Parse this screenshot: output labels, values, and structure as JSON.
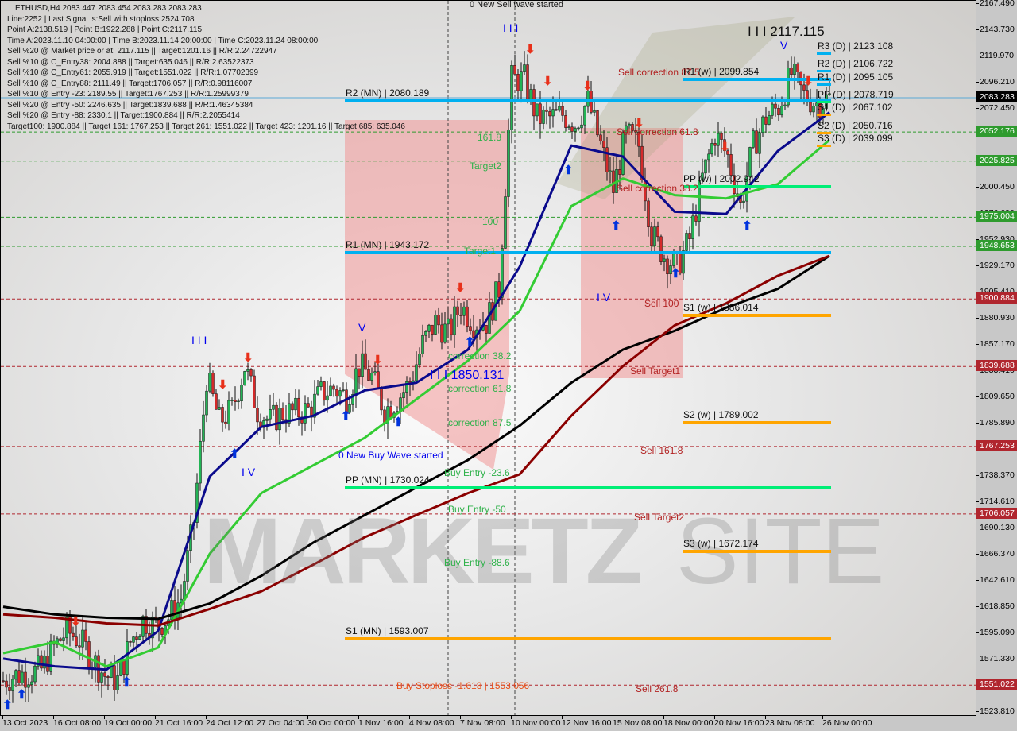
{
  "header": {
    "title": "ETHUSD,H4  2083.447 2083.454 2083.283 2083.283",
    "lines": [
      "Line:2252 | Last Signal is:Sell with stoploss:2524.708",
      "Point A:2138.519 | Point B:1922.288 | Point C:2117.115",
      "Time A:2023.11.10 04:00:00 | Time B:2023.11.14 20:00:00 | Time C:2023.11.24 08:00:00",
      "Sell %20 @ Market price or at: 2117.115 || Target:1201.16 || R/R:2.24722947",
      "Sell %10 @ C_Entry38: 2004.888 || Target:635.046 || R/R:2.63522373",
      "Sell %10 @ C_Entry61: 2055.919 || Target:1551.022 || R/R:1.07702399",
      "Sell %10 @ C_Entry88: 2111.49 || Target:1706.057 || R/R:0.98116007",
      "Sell %10 @ Entry -23: 2189.55 || Target:1767.253 || R/R:1.25999379",
      "Sell %20 @ Entry -50: 2246.635 || Target:1839.688 || R/R:1.46345384",
      "Sell %20 @ Entry -88: 2330.1 || Target:1900.884 || R/R:2.2055414",
      "Target100: 1900.884 || Target 161: 1767.253 || Target 261: 1551.022 || Target 423: 1201.16 || Target 685: 635.046"
    ]
  },
  "annotations": {
    "sell_wave": "0 New Sell wave started",
    "buy_wave": "0 New Buy Wave started",
    "wave3_top": "I I I",
    "wave3_price": "I I I  2117.115",
    "wave5_top": "V",
    "wave3_left": "I I I",
    "wave4_left": "I V",
    "wave5_left": "V",
    "wave4_right": "I V",
    "wave3_mid": "I I I  1850.131",
    "sell_corr_875": "Sell correction 87.5",
    "sell_corr_618": "Sell correction 61.8",
    "sell_corr_382": "Sell correction 38.2",
    "t1618": "161.8",
    "target2": "Target2",
    "t100": "100",
    "target1": "Target1",
    "sell_100": "Sell 100",
    "sell_target1": "Sell Target1",
    "sell_1618": "Sell 161.8",
    "sell_target2": "Sell Target2",
    "sell_2618": "Sell  261.8",
    "corr_382": "correction 38.2",
    "corr_618": "correction 61.8",
    "corr_875": "correction 87.5",
    "buy_entry_236": "Buy Entry -23.6",
    "buy_entry_50": "Buy Entry -50",
    "buy_entry_886": "Buy Entry -88.6",
    "buy_stoploss": "Buy Stoploss -1.618 | 1553.056",
    "watermark": "MARKETZ SITE"
  },
  "chart_data": {
    "type": "candlestick",
    "symbol": "ETHUSD",
    "timeframe": "H4",
    "ylim": [
      1523.81,
      2167.49
    ],
    "y_ticks": [
      "2167.490",
      "2143.730",
      "2119.970",
      "2096.210",
      "2072.450",
      "2047.970",
      "2024.210",
      "2000.450",
      "1976.690",
      "1952.930",
      "1929.170",
      "1905.410",
      "1880.930",
      "1857.170",
      "1833.410",
      "1809.650",
      "1785.890",
      "1762.130",
      "1738.370",
      "1714.610",
      "1690.130",
      "1666.370",
      "1642.610",
      "1618.850",
      "1595.090",
      "1571.330",
      "1547.570",
      "1523.810"
    ],
    "x_ticks": [
      "13 Oct 2023",
      "16 Oct 08:00",
      "19 Oct 00:00",
      "21 Oct 16:00",
      "24 Oct 12:00",
      "27 Oct 04:00",
      "30 Oct 00:00",
      "1 Nov 16:00",
      "4 Nov 08:00",
      "7 Nov 08:00",
      "10 Nov 00:00",
      "12 Nov 16:00",
      "15 Nov 08:00",
      "18 Nov 00:00",
      "20 Nov 16:00",
      "23 Nov 08:00",
      "26 Nov 00:00"
    ],
    "current_price": {
      "value": 2083.283,
      "label": "2083.283",
      "color": "#000000"
    },
    "price_tags": [
      {
        "value": 2052.176,
        "label": "2052.176",
        "color": "#2e9b2e"
      },
      {
        "value": 2025.825,
        "label": "2025.825",
        "color": "#2e9b2e"
      },
      {
        "value": 1975.004,
        "label": "1975.004",
        "color": "#2e9b2e"
      },
      {
        "value": 1948.653,
        "label": "1948.653",
        "color": "#2e9b2e"
      },
      {
        "value": 1900.884,
        "label": "1900.884",
        "color": "#b0262e"
      },
      {
        "value": 1839.688,
        "label": "1839.688",
        "color": "#b0262e"
      },
      {
        "value": 1767.253,
        "label": "1767.253",
        "color": "#b0262e"
      },
      {
        "value": 1706.057,
        "label": "1706.057",
        "color": "#b0262e"
      },
      {
        "value": 1551.022,
        "label": "1551.022",
        "color": "#b0262e"
      }
    ],
    "close_samples": [
      1555,
      1560,
      1562,
      1565,
      1585,
      1600,
      1592,
      1575,
      1560,
      1555,
      1590,
      1610,
      1605,
      1612,
      1630,
      1700,
      1830,
      1790,
      1800,
      1840,
      1800,
      1790,
      1798,
      1798,
      1800,
      1815,
      1820,
      1812,
      1840,
      1830,
      1800,
      1810,
      1825,
      1860,
      1880,
      1870,
      1895,
      1880,
      1880,
      1910,
      2100,
      2100,
      2065,
      2065,
      2068,
      2060,
      2080,
      2040,
      2000,
      2050,
      2040,
      1960,
      1940,
      1930,
      1955,
      2010,
      2050,
      2030,
      1985,
      2040,
      2065,
      2075,
      2105,
      2085,
      2078,
      2083
    ],
    "moving_averages": [
      {
        "color": "#0a0a8c",
        "values": [
          1575,
          1568,
          1565,
          1600,
          1740,
          1785,
          1795,
          1818,
          1825,
          1855,
          1930,
          2040,
          2030,
          1980,
          1978,
          2035,
          2070
        ]
      },
      {
        "color": "#33cc33",
        "values": [
          1580,
          1590,
          1568,
          1585,
          1670,
          1725,
          1750,
          1775,
          1810,
          1845,
          1890,
          1985,
          2010,
          1995,
          1992,
          2005,
          2045
        ]
      },
      {
        "color": "#000000",
        "values": [
          1622,
          1615,
          1612,
          1611,
          1625,
          1650,
          1680,
          1705,
          1730,
          1755,
          1786,
          1825,
          1855,
          1872,
          1893,
          1910,
          1940
        ]
      },
      {
        "color": "#8b0000",
        "values": [
          1615,
          1612,
          1607,
          1605,
          1620,
          1636,
          1660,
          1685,
          1705,
          1725,
          1742,
          1795,
          1840,
          1877,
          1897,
          1922,
          1940
        ]
      }
    ],
    "pivots": [
      {
        "group": "MN",
        "label": "R2 (MN) | 2080.189",
        "value": 2080.189,
        "color": "#00b0f0"
      },
      {
        "group": "MN",
        "label": "R1 (MN) | 1943.172",
        "value": 1943.172,
        "color": "#00b0f0"
      },
      {
        "group": "MN",
        "label": "PP (MN) | 1730.024",
        "value": 1730.024,
        "color": "#00ee76"
      },
      {
        "group": "MN",
        "label": "S1 (MN) | 1593.007",
        "value": 1593.007,
        "color": "#ffa500"
      },
      {
        "group": "w",
        "label": "R1 (w) | 2099.854",
        "value": 2099.854,
        "color": "#00b0f0"
      },
      {
        "group": "w",
        "label": "PP (w) | 2002.942",
        "value": 2002.942,
        "color": "#00ee76"
      },
      {
        "group": "w",
        "label": "S1 (w) | 1886.014",
        "value": 1886.014,
        "color": "#ffa500"
      },
      {
        "group": "w",
        "label": "S2 (w) | 1789.002",
        "value": 1789.002,
        "color": "#ffa500"
      },
      {
        "group": "w",
        "label": "S3 (w) | 1672.174",
        "value": 1672.174,
        "color": "#ffa500"
      },
      {
        "group": "D",
        "label": "R3 (D) | 2123.108",
        "value": 2123.108,
        "color": "#00b0f0"
      },
      {
        "group": "D",
        "label": "R2 (D) | 2106.722",
        "value": 2106.722,
        "color": "#00b0f0"
      },
      {
        "group": "D",
        "label": "R1 (D) | 2095.105",
        "value": 2095.105,
        "color": "#00b0f0"
      },
      {
        "group": "D",
        "label": "PP (D) | 2078.719",
        "value": 2078.719,
        "color": "#00ee76"
      },
      {
        "group": "D",
        "label": "S1 (D) | 2067.102",
        "value": 2067.102,
        "color": "#ffa500"
      },
      {
        "group": "D",
        "label": "S2 (D) | 2050.716",
        "value": 2050.716,
        "color": "#ffa500"
      },
      {
        "group": "D",
        "label": "S3 (D) | 2039.099",
        "value": 2039.099,
        "color": "#ffa500"
      }
    ]
  }
}
